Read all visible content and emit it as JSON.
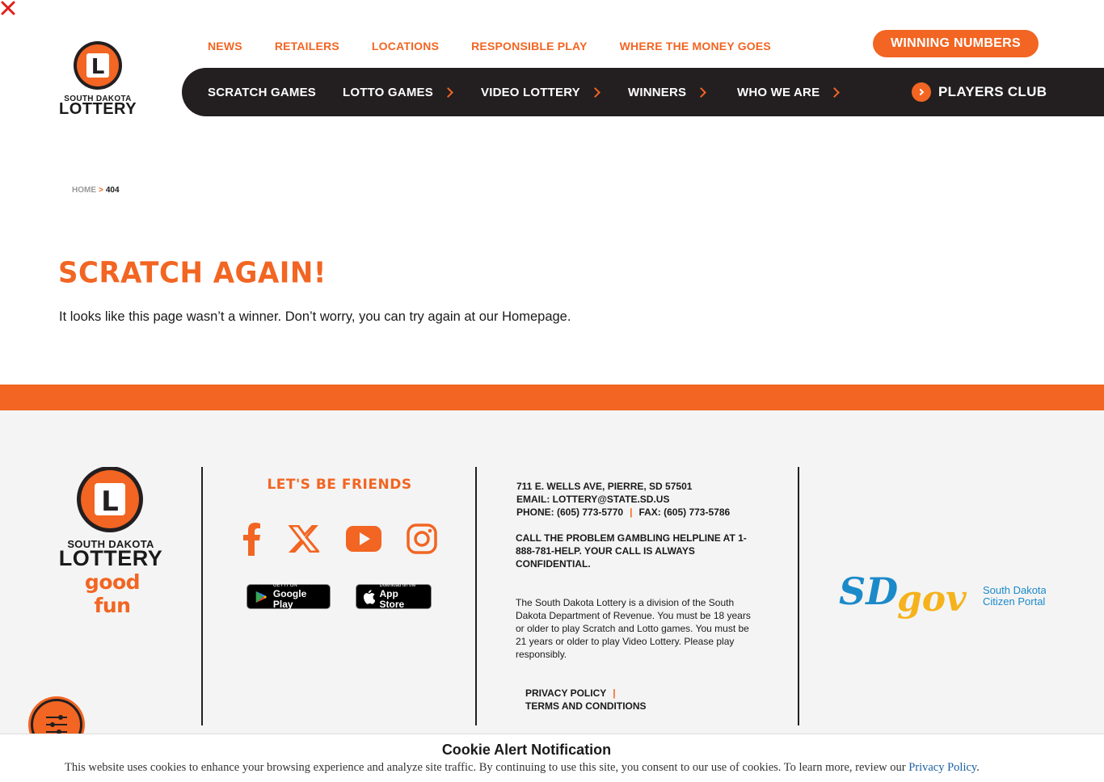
{
  "header": {
    "logo": {
      "line1": "SOUTH DAKOTA",
      "line2": "LOTTERY",
      "letter": "L"
    },
    "top_links": [
      "NEWS",
      "RETAILERS",
      "LOCATIONS",
      "RESPONSIBLE PLAY",
      "WHERE THE MONEY GOES"
    ],
    "winning_numbers_label": "WINNING NUMBERS",
    "main_nav": [
      {
        "label": "SCRATCH GAMES",
        "has_chevron": false
      },
      {
        "label": "LOTTO GAMES",
        "has_chevron": true
      },
      {
        "label": "VIDEO LOTTERY",
        "has_chevron": true
      },
      {
        "label": "WINNERS",
        "has_chevron": true
      },
      {
        "label": "WHO WE ARE",
        "has_chevron": true
      }
    ],
    "players_club_label": "PLAYERS CLUB"
  },
  "breadcrumb": {
    "home": "HOME",
    "separator": ">",
    "current": "404"
  },
  "main": {
    "title": "Scratch Again!",
    "message": "It looks like this page wasn’t a winner. Don’t worry, you can try again at our Homepage."
  },
  "footer": {
    "logo": {
      "line1": "SOUTH DAKOTA",
      "line2": "LOTTERY",
      "tagline": "good fun",
      "letter": "L"
    },
    "friends_title": "Let's Be Friends",
    "social_icons": [
      "facebook-icon",
      "x-icon",
      "youtube-icon",
      "instagram-icon"
    ],
    "stores": {
      "google": {
        "small": "GET IT ON",
        "big": "Google Play"
      },
      "apple": {
        "small": "Download on the",
        "big": "App Store"
      }
    },
    "contact": {
      "address": "711 E. WELLS AVE, PIERRE, SD 57501",
      "email": "EMAIL: LOTTERY@STATE.SD.US",
      "phone": "PHONE: (605) 773-5770",
      "separator": "|",
      "fax": "FAX: (605) 773-5786"
    },
    "helpline": "CALL THE PROBLEM GAMBLING HELPLINE AT 1-888-781-HELP. YOUR CALL IS ALWAYS CONFIDENTIAL.",
    "disclaimer": "The South Dakota Lottery is a division of the South Dakota Department of Revenue. You must be 18 years or older to play Scratch and Lotto games. You must be 21 years or older to play Video Lottery. Please play responsibly.",
    "legal": {
      "privacy": "PRIVACY POLICY",
      "separator": "|",
      "terms": "TERMS AND CONDITIONS"
    },
    "sdgov": {
      "sd": "SD",
      "gov": "gov",
      "portal_line1": "South Dakota's",
      "portal_line2": "Citizen Portal"
    }
  },
  "cookie": {
    "title": "Cookie Alert Notification",
    "text": "This website uses cookies to enhance your browsing experience and analyze site traffic. By continuing to use this site, you consent to our use of cookies. To learn more, review our ",
    "link": "Privacy Policy",
    "period": "."
  },
  "colors": {
    "accent": "#f26522",
    "dark": "#231f20",
    "footer_bg": "#f4f4f4",
    "sdgov_blue": "#1b8ac9",
    "sdgov_yellow": "#f5b21b"
  }
}
